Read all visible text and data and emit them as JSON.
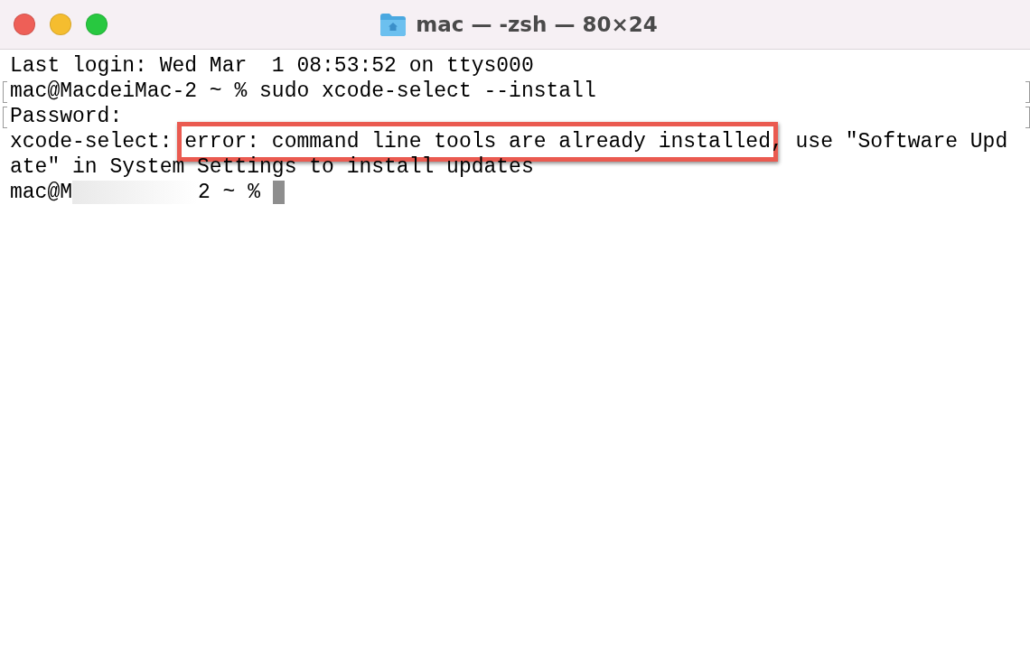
{
  "window": {
    "title": "mac — -zsh — 80×24"
  },
  "terminal": {
    "lines": [
      {
        "marked": false,
        "cursor": false,
        "segments": [
          {
            "kind": "plain",
            "text": "Last login: Wed Mar  1 08:53:52 on ttys000"
          }
        ]
      },
      {
        "marked": true,
        "cursor": false,
        "segments": [
          {
            "kind": "plain",
            "text": "mac@MacdeiMac-2 ~ % sudo xcode-select --install"
          }
        ]
      },
      {
        "marked": true,
        "cursor": false,
        "segments": [
          {
            "kind": "plain",
            "text": "Password:"
          }
        ]
      },
      {
        "marked": false,
        "cursor": false,
        "segments": [
          {
            "kind": "plain",
            "text": "xcode-select: "
          },
          {
            "kind": "highlight",
            "text": "error: command line tools are already installed"
          },
          {
            "kind": "plain",
            "text": ", use \"Software Upd"
          }
        ]
      },
      {
        "marked": false,
        "cursor": false,
        "segments": [
          {
            "kind": "plain",
            "text": "ate\" in System Settings to install updates"
          }
        ]
      },
      {
        "marked": false,
        "cursor": true,
        "segments": [
          {
            "kind": "plain",
            "text": "mac@M"
          },
          {
            "kind": "redacted"
          },
          {
            "kind": "plain",
            "text": "2 ~ %"
          }
        ]
      }
    ]
  }
}
